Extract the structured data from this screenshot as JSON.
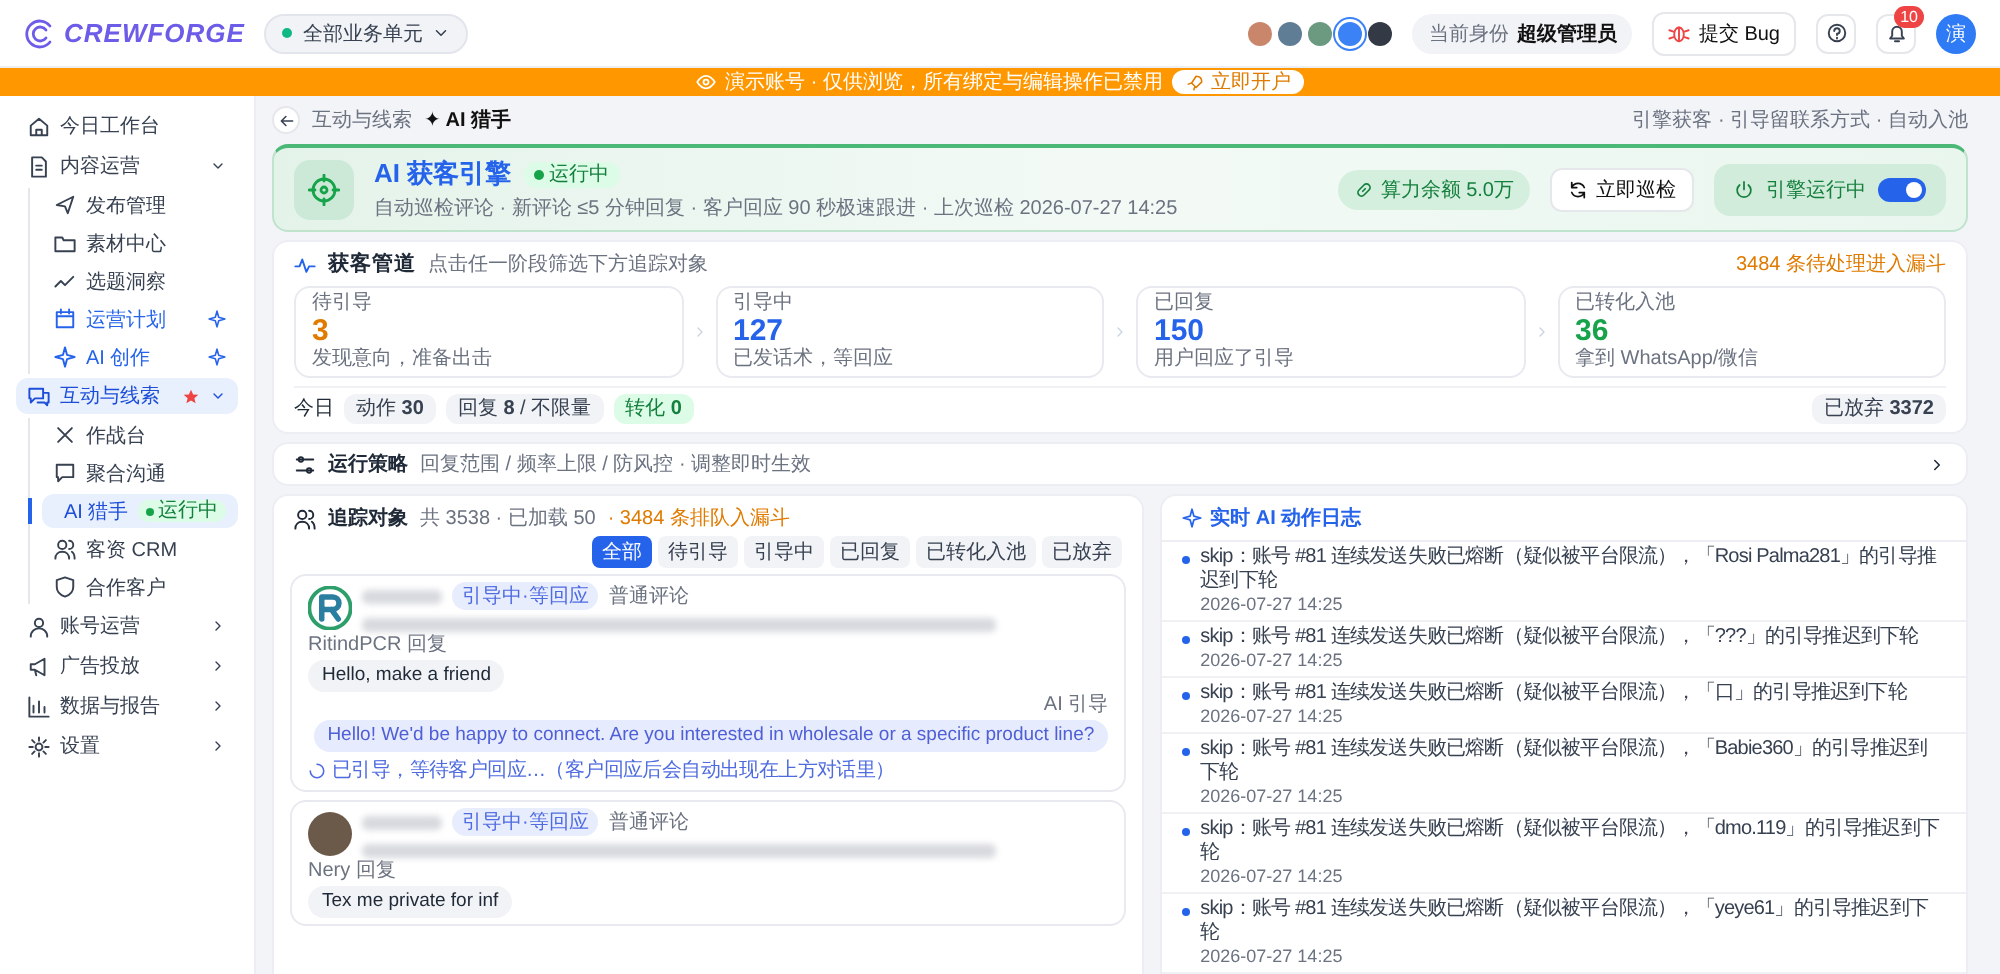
{
  "topbar": {
    "logo": "CREWFORGE",
    "workspace": "全部业务单元",
    "accounts": [
      {
        "color": "#c9866a",
        "selected": false
      },
      {
        "color": "#5f7d95",
        "selected": false
      },
      {
        "color": "#6b9a80",
        "selected": false
      },
      {
        "color": "#3b82f6",
        "selected": true
      },
      {
        "color": "#333a45",
        "selected": false
      }
    ],
    "identity_label": "当前身份",
    "identity": "超级管理员",
    "bug_button": "提交 Bug",
    "notifications": "10",
    "avatar": "演"
  },
  "banner": {
    "text": "演示账号 · 仅供浏览，所有绑定与编辑操作已禁用",
    "button": "立即开户"
  },
  "sidebar": {
    "items": [
      {
        "label": "今日工作台",
        "selected": false,
        "starred": false
      },
      {
        "label": "内容运营",
        "selected": false,
        "starred": false,
        "expanded": true,
        "children": [
          {
            "label": "发布管理",
            "selected": false,
            "featured": false
          },
          {
            "label": "素材中心",
            "selected": false,
            "featured": false
          },
          {
            "label": "选题洞察",
            "selected": false,
            "featured": false
          },
          {
            "label": "运营计划",
            "selected": false,
            "featured": true
          },
          {
            "label": "AI 创作",
            "selected": false,
            "featured": true
          }
        ]
      },
      {
        "label": "互动与线索",
        "selected": true,
        "starred": true,
        "expanded": true,
        "children": [
          {
            "label": "作战台",
            "selected": false,
            "featured": false
          },
          {
            "label": "聚合沟通",
            "selected": false,
            "featured": false
          },
          {
            "label": "AI 猎手",
            "selected": true,
            "featured": false,
            "badge": "运行中"
          },
          {
            "label": "客资 CRM",
            "selected": false,
            "featured": false
          },
          {
            "label": "合作客户",
            "selected": false,
            "featured": false
          }
        ]
      },
      {
        "label": "账号运营",
        "selected": false,
        "starred": false,
        "expanded": false
      },
      {
        "label": "广告投放",
        "selected": false,
        "starred": false,
        "expanded": false
      },
      {
        "label": "数据与报告",
        "selected": false,
        "starred": false,
        "expanded": false
      },
      {
        "label": "设置",
        "selected": false,
        "starred": false,
        "expanded": false
      }
    ]
  },
  "breadcrumb": {
    "parent": "互动与线索",
    "current": "✦ AI 猎手",
    "note": "引擎获客 · 引导留联系方式 · 自动入池"
  },
  "engine": {
    "title": "AI 获客引擎",
    "status": "运行中",
    "description": "自动巡检评论 · 新评论 ≤5 分钟回复 · 客户回应 90 秒极速跟进 · 上次巡检 2026-07-27 14:25",
    "balance": "算力余额 5.0万",
    "check_button": "立即巡检",
    "switch_label": "引擎运行中",
    "on": true
  },
  "pipeline": {
    "title": "获客管道",
    "hint": "点击任一阶段筛选下方追踪对象",
    "queue": "3484 条待处理进入漏斗",
    "stages": [
      {
        "label": "待引导",
        "value": "3",
        "note": "发现意向，准备出击",
        "color": "#e07b00"
      },
      {
        "label": "引导中",
        "value": "127",
        "note": "已发话术，等回应",
        "color": "#2563eb"
      },
      {
        "label": "已回复",
        "value": "150",
        "note": "用户回应了引导",
        "color": "#2563eb"
      },
      {
        "label": "已转化入池",
        "value": "36",
        "note": "拿到 WhatsApp/微信",
        "color": "#16a34a"
      }
    ],
    "today_label": "今日",
    "chips": [
      {
        "text": "动作 **30**",
        "kind": "plain"
      },
      {
        "text": "回复 **8** / 不限量",
        "kind": "plain"
      },
      {
        "text": "转化 **0**",
        "kind": "success"
      }
    ],
    "abandoned": "已放弃 **3372**"
  },
  "strategy": {
    "title": "运行策略",
    "description": "回复范围 / 频率上限 / 防风控 · 调整即时生效"
  },
  "tracking": {
    "title": "追踪对象",
    "count": "共 3538 · 已加载 50",
    "queue": "· 3484 条排队入漏斗",
    "filters": [
      {
        "label": "全部",
        "selected": true
      },
      {
        "label": "待引导",
        "selected": false
      },
      {
        "label": "引导中",
        "selected": false
      },
      {
        "label": "已回复",
        "selected": false
      },
      {
        "label": "已转化入池",
        "selected": false
      },
      {
        "label": "已放弃",
        "selected": false
      }
    ],
    "conversations": [
      {
        "kind": "brand",
        "tag": "引导中·等回应",
        "source": "普通评论",
        "messages": [
          {
            "kind": "incoming",
            "label": "RitindPCR 回复",
            "text": "Hello, make a friend"
          },
          {
            "kind": "ai",
            "label": "AI 引导",
            "text": "Hello! We'd be happy to connect. Are you interested in wholesale or a specific product line?"
          }
        ],
        "status": "已引导，等待客户回应…（客户回应后会自动出现在上方对话里）"
      },
      {
        "kind": "person",
        "tag": "引导中·等回应",
        "source": "普通评论",
        "messages": [
          {
            "kind": "incoming",
            "label": "Nery 回复",
            "text": "Tex me private for inf"
          }
        ]
      }
    ]
  },
  "log": {
    "title": "实时 AI 动作日志",
    "entries": [
      {
        "text": "skip：账号 #81 连续发送失败已熔断（疑似被平台限流），「Rosi Palma281」的引导推迟到下轮",
        "time": "2026-07-27 14:25"
      },
      {
        "text": "skip：账号 #81 连续发送失败已熔断（疑似被平台限流），「???」的引导推迟到下轮",
        "time": "2026-07-27 14:25"
      },
      {
        "text": "skip：账号 #81 连续发送失败已熔断（疑似被平台限流），「口」的引导推迟到下轮",
        "time": "2026-07-27 14:25"
      },
      {
        "text": "skip：账号 #81 连续发送失败已熔断（疑似被平台限流），「Babie360」的引导推迟到下轮",
        "time": "2026-07-27 14:25"
      },
      {
        "text": "skip：账号 #81 连续发送失败已熔断（疑似被平台限流），「dmo.119」的引导推迟到下轮",
        "time": "2026-07-27 14:25"
      },
      {
        "text": "skip：账号 #81 连续发送失败已熔断（疑似被平台限流），「yeye61」的引导推迟到下轮",
        "time": "2026-07-27 14:25"
      }
    ]
  }
}
